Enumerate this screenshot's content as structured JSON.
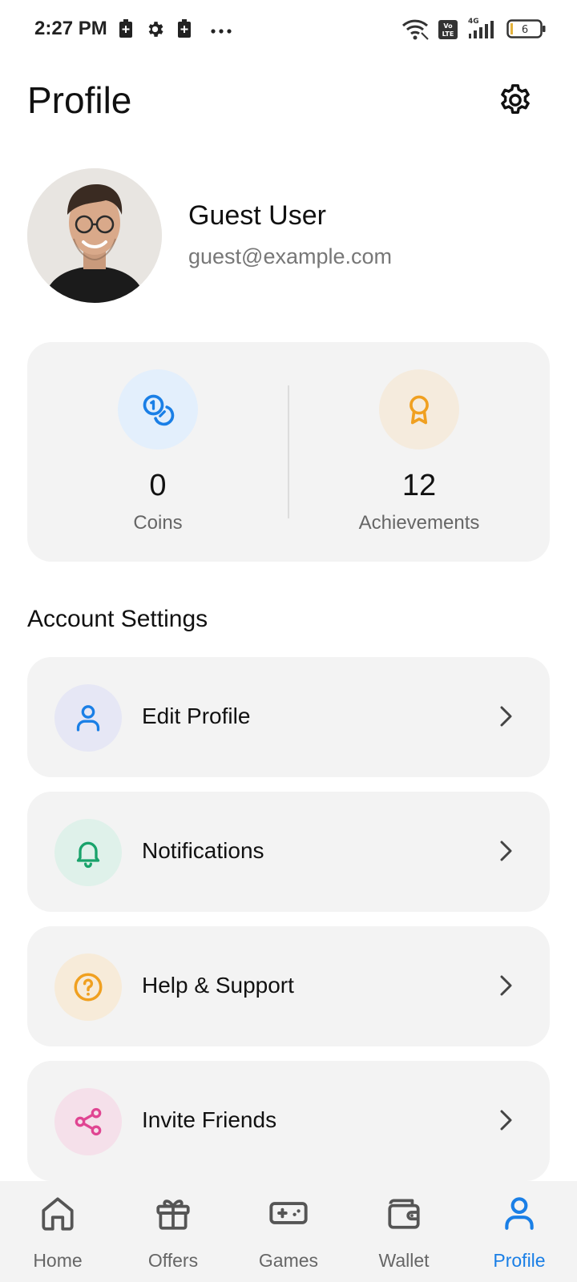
{
  "status_bar": {
    "time": "2:27 PM",
    "battery_level": "6",
    "network_label": "4G",
    "volte_label": "Vo LTE"
  },
  "header": {
    "title": "Profile"
  },
  "user": {
    "name": "Guest User",
    "email": "guest@example.com"
  },
  "stats": {
    "coins": {
      "value": "0",
      "label": "Coins"
    },
    "achievements": {
      "value": "12",
      "label": "Achievements"
    }
  },
  "account_settings": {
    "title": "Account Settings",
    "items": [
      {
        "label": "Edit Profile",
        "icon": "user-icon",
        "color": "#1a7fe6",
        "bg": "#e6e7f5"
      },
      {
        "label": "Notifications",
        "icon": "bell-icon",
        "color": "#19a36b",
        "bg": "#dff1ea"
      },
      {
        "label": "Help & Support",
        "icon": "help-circle-icon",
        "color": "#f0a020",
        "bg": "#f7ebd9"
      },
      {
        "label": "Invite Friends",
        "icon": "share-icon",
        "color": "#e04592",
        "bg": "#f5e0ea"
      }
    ]
  },
  "bottom_nav": {
    "items": [
      {
        "label": "Home",
        "icon": "home-icon"
      },
      {
        "label": "Offers",
        "icon": "gift-icon"
      },
      {
        "label": "Games",
        "icon": "gamepad-icon"
      },
      {
        "label": "Wallet",
        "icon": "wallet-icon"
      },
      {
        "label": "Profile",
        "icon": "user-icon",
        "active": true
      }
    ]
  },
  "colors": {
    "accent": "#1a7fe6",
    "card_bg": "#f3f3f3",
    "coins_circle": "#e3effc",
    "achievements_circle": "#f5ebdd",
    "achievements_icon": "#f0a020"
  }
}
